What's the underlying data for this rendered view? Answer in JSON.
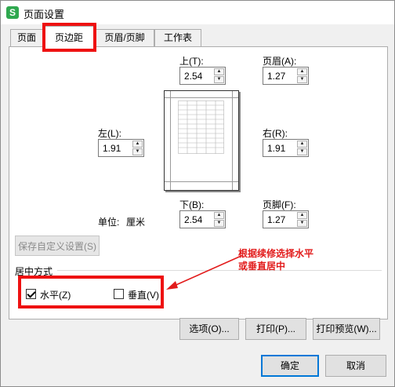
{
  "window": {
    "title": "页面设置",
    "app_icon_letter": "S"
  },
  "tabs": [
    {
      "label": "页面",
      "active": false
    },
    {
      "label": "页边距",
      "active": true
    },
    {
      "label": "页眉/页脚",
      "active": false
    },
    {
      "label": "工作表",
      "active": false
    }
  ],
  "margins": {
    "top": {
      "label": "上(T):",
      "value": "2.54"
    },
    "header": {
      "label": "页眉(A):",
      "value": "1.27"
    },
    "left": {
      "label": "左(L):",
      "value": "1.91"
    },
    "right": {
      "label": "右(R):",
      "value": "1.91"
    },
    "bottom": {
      "label": "下(B):",
      "value": "2.54"
    },
    "footer": {
      "label": "页脚(F):",
      "value": "1.27"
    },
    "unit_label": "单位:",
    "unit_value": "厘米"
  },
  "save_custom_label": "保存自定义设置(S)",
  "centering": {
    "group_label": "居中方式",
    "horizontal": {
      "label": "水平(Z)",
      "checked": true
    },
    "vertical": {
      "label": "垂直(V)",
      "checked": false
    }
  },
  "annotation": {
    "line1": "根据续修选择水平",
    "line2": "或垂直居中"
  },
  "buttons": {
    "options": "选项(O)...",
    "print": "打印(P)...",
    "print_preview": "打印预览(W)...",
    "ok": "确定",
    "cancel": "取消"
  },
  "colors": {
    "highlight": "#ee1111",
    "annotation_text": "#e21b1b",
    "app_icon": "#2fa84f"
  }
}
